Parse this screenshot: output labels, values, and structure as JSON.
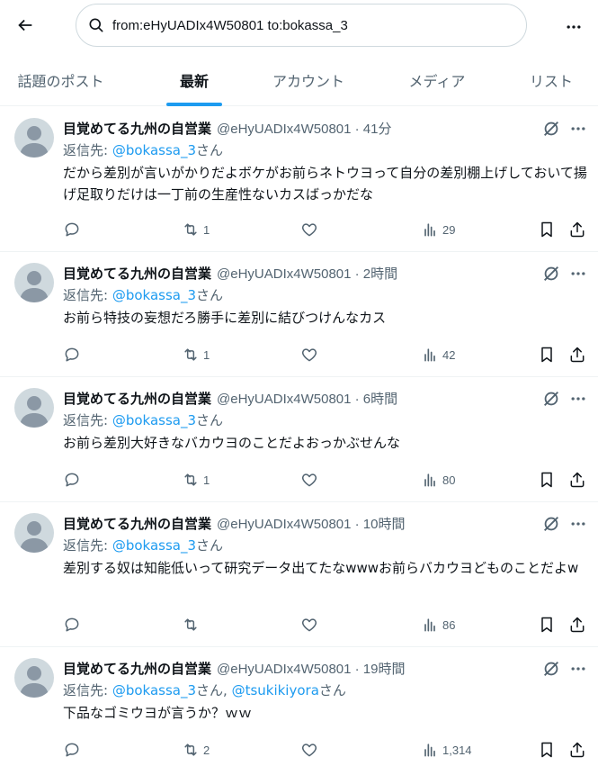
{
  "search": {
    "query": "from:eHyUADIx4W50801 to:bokassa_3"
  },
  "tabs": [
    {
      "label": "話題のポスト"
    },
    {
      "label": "最新"
    },
    {
      "label": "アカウント"
    },
    {
      "label": "メディア"
    },
    {
      "label": "リスト"
    }
  ],
  "active_tab": "最新",
  "colors": {
    "accent": "#1d9bf0",
    "text": "#0f1419",
    "secondary": "#536471",
    "border": "#eff3f4"
  },
  "tweets": [
    {
      "display_name": "目覚めてる九州の自営業",
      "handle": "@eHyUADIx4W50801 · 41分",
      "reply_prefix": "返信先: ",
      "reply_to": "@bokassa_3",
      "reply_suffix": "さん",
      "text": "だから差別が言いがかりだよボケがお前らネトウヨって自分の差別棚上げしておいて揚げ足取りだけは一丁前の生産性ないカスばっかだな",
      "retweets": "1",
      "views": "29"
    },
    {
      "display_name": "目覚めてる九州の自営業",
      "handle": "@eHyUADIx4W50801 · 2時間",
      "reply_prefix": "返信先: ",
      "reply_to": "@bokassa_3",
      "reply_suffix": "さん",
      "text": "お前ら特技の妄想だろ勝手に差別に結びつけんなカス",
      "retweets": "1",
      "views": "42"
    },
    {
      "display_name": "目覚めてる九州の自営業",
      "handle": "@eHyUADIx4W50801 · 6時間",
      "reply_prefix": "返信先: ",
      "reply_to": "@bokassa_3",
      "reply_suffix": "さん",
      "text": "お前ら差別大好きなバカウヨのことだよおっかぶせんな",
      "retweets": "1",
      "views": "80"
    },
    {
      "display_name": "目覚めてる九州の自営業",
      "handle": "@eHyUADIx4W50801 · 10時間",
      "reply_prefix": "返信先: ",
      "reply_to": "@bokassa_3",
      "reply_suffix": "さん",
      "text": "差別する奴は知能低いって研究データ出てたなwwwお前らバカウヨどものことだよw",
      "retweets": "",
      "views": "86"
    },
    {
      "display_name": "目覚めてる九州の自営業",
      "handle": "@eHyUADIx4W50801 · 19時間",
      "reply_prefix": "返信先: ",
      "reply_to": "@bokassa_3",
      "reply_suffix": "さん, ",
      "reply_to_2": "@tsukikiyora",
      "reply_suffix_2": "さん",
      "text": "下品なゴミウヨが言うか？ｗｗ",
      "retweets": "2",
      "views": "1,314"
    }
  ]
}
